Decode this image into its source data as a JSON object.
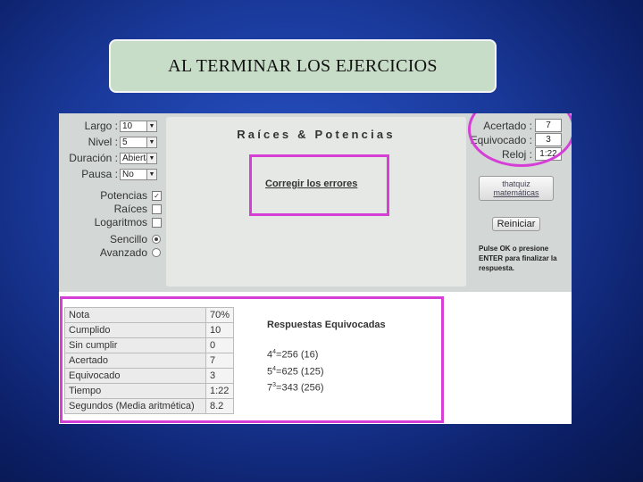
{
  "slide": {
    "title": "AL TERMINAR LOS EJERCICIOS"
  },
  "settings": {
    "largo_label": "Largo :",
    "largo_value": "10",
    "nivel_label": "Nivel :",
    "nivel_value": "5",
    "duracion_label": "Duración :",
    "duracion_value": "Abierta",
    "pausa_label": "Pausa :",
    "pausa_value": "No",
    "potencias_label": "Potencias",
    "potencias_checked": "✓",
    "raices_label": "Raíces",
    "logaritmos_label": "Logaritmos",
    "sencillo_label": "Sencillo",
    "avanzado_label": "Avanzado"
  },
  "main": {
    "title": "Raíces & Potencias",
    "correct_link": "Corregir los errores"
  },
  "score": {
    "acertado_label": "Acertado :",
    "acertado_value": "7",
    "equivocado_label": "Equivocado :",
    "equivocado_value": "3",
    "reloj_label": "Reloj :",
    "reloj_value": "1:22",
    "brand_line1": "thatquiz",
    "brand_line2": "matemáticas",
    "reset_label": "Reiniciar",
    "hint": "Pulse OK o presione ENTER para finalizar la respuesta."
  },
  "results": {
    "rows": [
      {
        "k": "Nota",
        "v": "70%"
      },
      {
        "k": "Cumplido",
        "v": "10"
      },
      {
        "k": "Sin cumplir",
        "v": "0"
      },
      {
        "k": "Acertado",
        "v": "7"
      },
      {
        "k": "Equivocado",
        "v": "3"
      },
      {
        "k": "Tiempo",
        "v": "1:22"
      },
      {
        "k": "Segundos (Media aritmética)",
        "v": "8.2"
      }
    ]
  },
  "wrong": {
    "title": "Respuestas Equivocadas",
    "items": [
      {
        "base": "4",
        "exp": "4",
        "rest": "=256 (16)"
      },
      {
        "base": "5",
        "exp": "4",
        "rest": "=625 (125)"
      },
      {
        "base": "7",
        "exp": "3",
        "rest": "=343 (256)"
      }
    ]
  },
  "colors": {
    "highlight": "#d63fd6",
    "background": "#1a3a9c"
  }
}
